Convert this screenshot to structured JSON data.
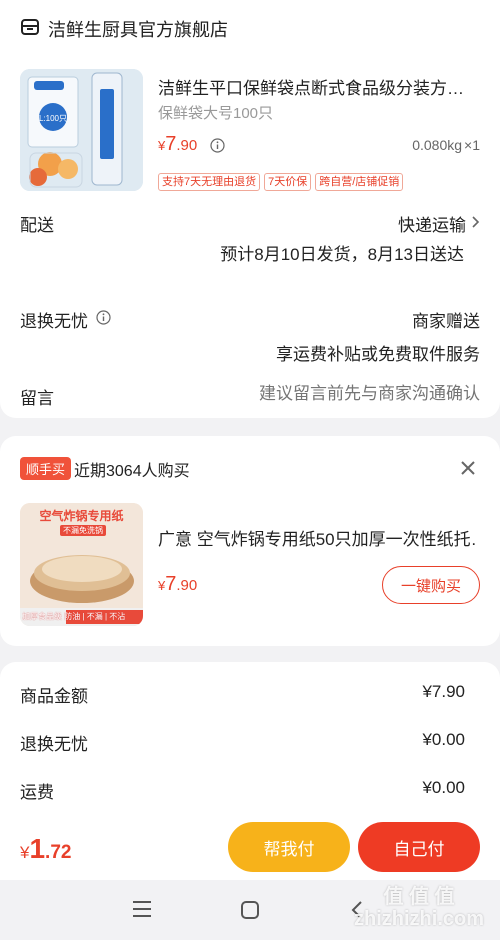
{
  "shop": {
    "name": "洁鲜生厨具官方旗舰店",
    "product": {
      "title": "洁鲜生平口保鲜袋点断式食品级分装方…",
      "spec": "保鲜袋大号100只",
      "price_symbol": "¥",
      "price_int": "7",
      "price_dec": ".90",
      "weight": "0.080kg",
      "qty": "×1",
      "thumb_text": "L:100只",
      "tags": [
        "支持7天无理由退货",
        "7天价保",
        "跨自营/店铺促销"
      ]
    }
  },
  "delivery": {
    "label": "配送",
    "method": "快递运输",
    "eta": "预计8月10日发货，8月13日送达"
  },
  "returns": {
    "label": "退换无忧",
    "value": "商家赠送",
    "service": "享运费补贴或免费取件服务"
  },
  "message": {
    "label": "留言",
    "placeholder": "建议留言前先与商家沟通确认"
  },
  "addon": {
    "badge": "顺手买",
    "recent": "近期3064人购买",
    "title": "广意 空气炸锅专用纸50只加厚一次性纸托…",
    "price_symbol": "¥",
    "price_int": "7",
    "price_dec": ".90",
    "buy_label": "一键购买",
    "img_text_top": "空气炸锅专用纸",
    "img_text_sub": "不漏免洗锅",
    "img_text_bottom": "加厚食品级 防油 | 不漏 | 不沾"
  },
  "summary": {
    "items": [
      {
        "label": "商品金额",
        "value": "¥7.90"
      },
      {
        "label": "退换无忧",
        "value": "¥0.00"
      },
      {
        "label": "运费",
        "value": "¥0.00"
      }
    ]
  },
  "footer": {
    "total_symbol": "¥",
    "total_int": "1",
    "total_dec": ".72",
    "help_pay": "帮我付",
    "self_pay": "自己付"
  },
  "watermark": "值 值 值 zhizhizhi.com",
  "colors": {
    "accent": "#e8402a",
    "help_pay": "#f7b21a",
    "self_pay": "#ee3b24",
    "page_bg": "#f2f2f4"
  }
}
